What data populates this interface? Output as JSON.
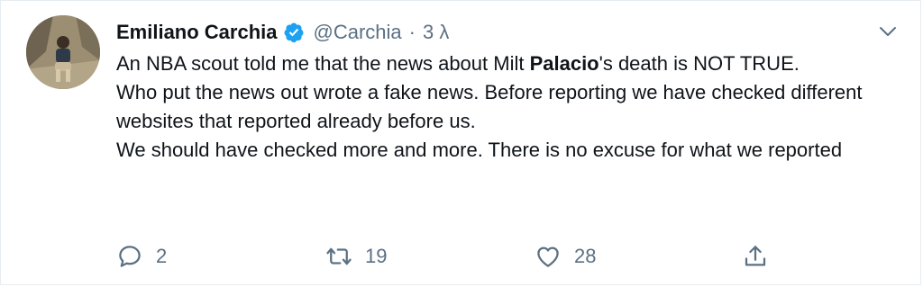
{
  "author": {
    "name": "Emiliano Carchia",
    "handle": "@Carchia",
    "separator": "·",
    "time": "3 λ"
  },
  "tweet": {
    "line1_before": "An NBA scout told me that the news about Milt ",
    "line1_bold": "Palacio",
    "line1_after": "'s death is NOT TRUE.",
    "line2": "Who put the news out wrote a fake news. Before reporting we have checked different websites that reported already before us.",
    "line3": "We should have checked more and more. There is no excuse for what we reported"
  },
  "actions": {
    "replies": "2",
    "retweets": "19",
    "likes": "28"
  },
  "icons": {
    "verified": "verified-badge-icon",
    "caret": "chevron-down-icon",
    "reply": "reply-icon",
    "retweet": "retweet-icon",
    "like": "heart-icon",
    "share": "share-icon"
  },
  "colors": {
    "verified": "#1da1f2",
    "secondary_text": "#5b7083",
    "text": "#0f1419"
  }
}
